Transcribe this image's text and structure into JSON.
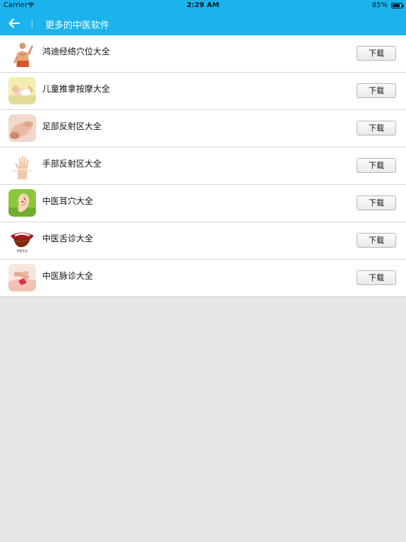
{
  "status_bar": {
    "carrier": "Carrier",
    "time": "2:29 AM",
    "battery": "85%",
    "battery_level": 0.85
  },
  "nav": {
    "title": "更多的中医软件"
  },
  "apps": [
    {
      "name": "鸿迪经络穴位大全",
      "button": "下载",
      "icon": "meridian-man-icon"
    },
    {
      "name": "儿童推拿按摩大全",
      "button": "下载",
      "icon": "baby-massage-icon"
    },
    {
      "name": "足部反射区大全",
      "button": "下载",
      "icon": "foot-reflex-icon"
    },
    {
      "name": "手部反射区大全",
      "button": "下载",
      "icon": "hand-reflex-icon"
    },
    {
      "name": "中医耳穴大全",
      "button": "下载",
      "icon": "ear-acupoint-icon"
    },
    {
      "name": "中医舌诊大全",
      "button": "下载",
      "icon": "tongue-diagnosis-icon",
      "icon_caption": "中医舌诊"
    },
    {
      "name": "中医脉诊大全",
      "button": "下载",
      "icon": "pulse-diagnosis-icon"
    }
  ]
}
